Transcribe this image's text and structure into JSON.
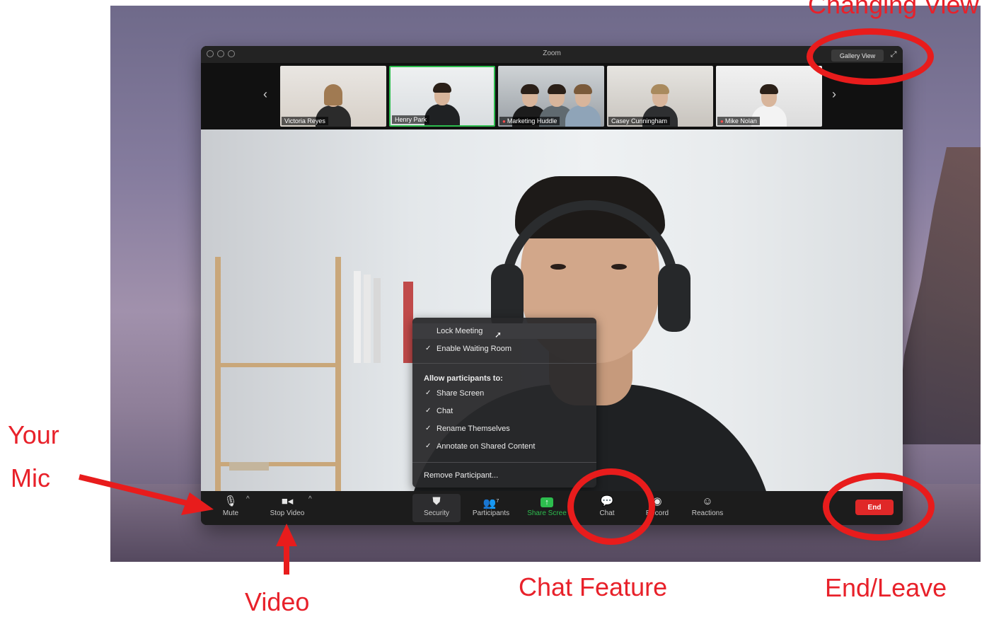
{
  "window": {
    "title": "Zoom",
    "view_button": "Gallery View"
  },
  "participants": [
    {
      "name": "Victoria Reyes",
      "muted": false
    },
    {
      "name": "Henry Park",
      "muted": false,
      "active": true
    },
    {
      "name": "Marketing Huddle",
      "muted": true
    },
    {
      "name": "Casey Cunningham",
      "muted": false
    },
    {
      "name": "Mike Nolan",
      "muted": true
    }
  ],
  "security_menu": {
    "lock_meeting": "Lock Meeting",
    "enable_waiting_room": "Enable Waiting Room",
    "allow_heading": "Allow participants to:",
    "allow_items": [
      "Share Screen",
      "Chat",
      "Rename Themselves",
      "Annotate on Shared Content"
    ],
    "remove_participant": "Remove Participant..."
  },
  "toolbar": {
    "mute": "Mute",
    "stop_video": "Stop Video",
    "security": "Security",
    "participants": "Participants",
    "participants_count": "7",
    "share_screen": "Share Scree",
    "chat": "Chat",
    "record": "Record",
    "reactions": "Reactions",
    "end": "End"
  },
  "annotations": {
    "changing_view": "Changing View",
    "your_mic_line1": "Your",
    "your_mic_line2": "Mic",
    "video": "Video",
    "chat_feature": "Chat Feature",
    "end_leave": "End/Leave"
  },
  "colors": {
    "accent_green": "#2dbd4e",
    "end_red": "#e02828",
    "annotation_red": "#e8212a"
  },
  "icons": [
    "microphone-icon",
    "video-camera-icon",
    "shield-icon",
    "participants-icon",
    "share-screen-icon",
    "chat-icon",
    "record-icon",
    "reactions-icon",
    "fullscreen-icon"
  ]
}
